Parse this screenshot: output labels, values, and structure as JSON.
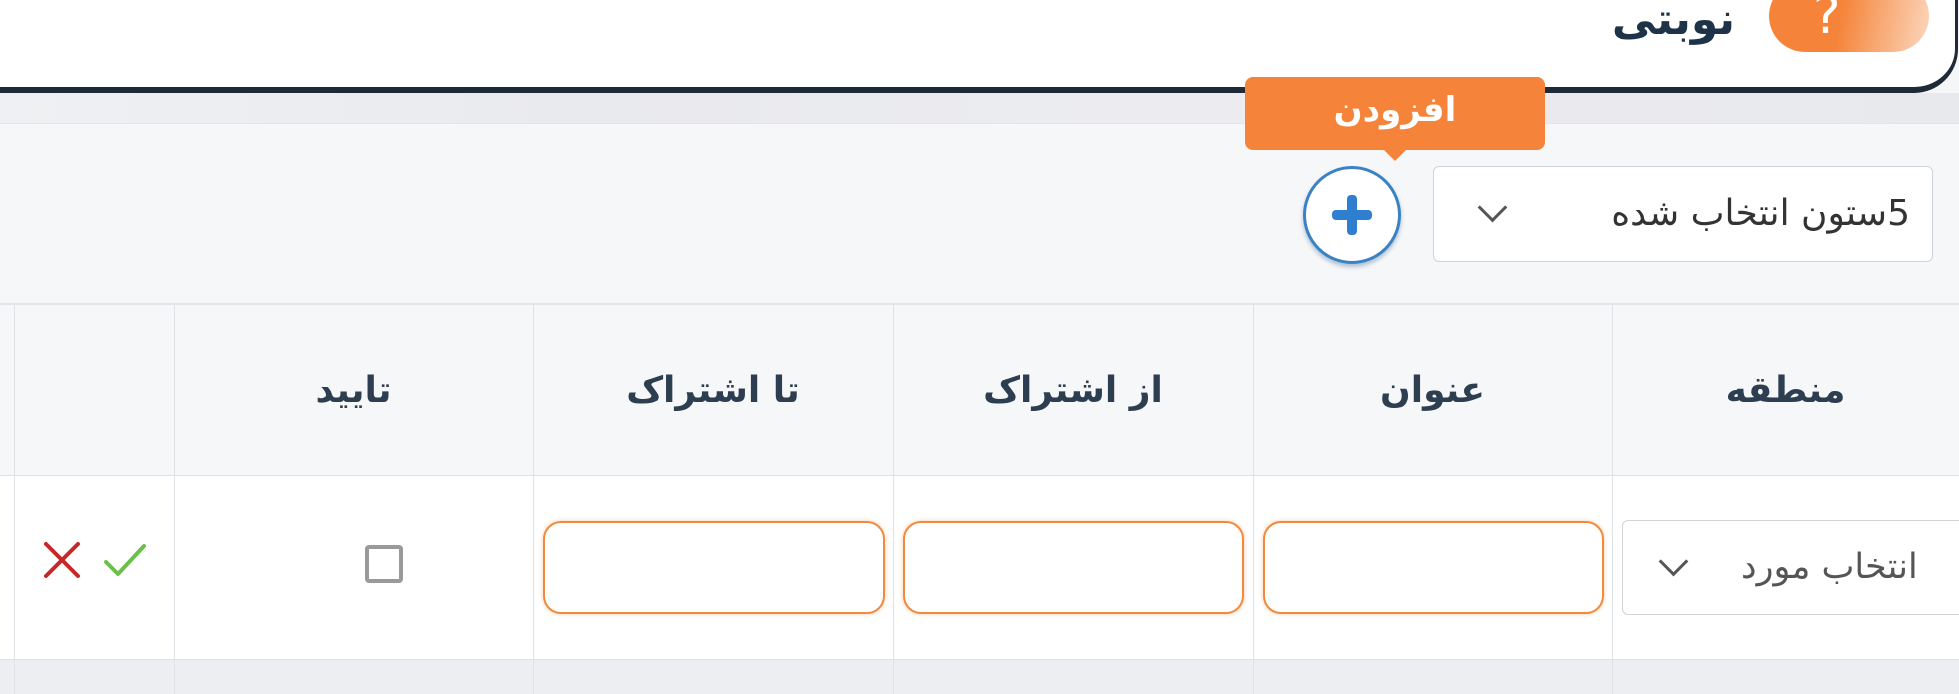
{
  "header": {
    "title": "نوبتی",
    "help_icon": "?"
  },
  "toolbar": {
    "column_select_value": "5ستون انتخاب شده",
    "add_tooltip": "افزودن",
    "add_icon": "plus-icon"
  },
  "table": {
    "columns": [
      "منطقه",
      "عنوان",
      "از اشتراک",
      "تا اشتراک",
      "تایید"
    ],
    "new_row": {
      "region_placeholder": "انتخاب مورد",
      "title": "",
      "from_subscription": "",
      "to_subscription": "",
      "approved": false
    }
  },
  "colors": {
    "accent": "#f5843a",
    "primary_blue": "#2f7fd0",
    "header_border": "#1e2a38",
    "confirm_green": "#6cc04a",
    "cancel_red": "#c62828"
  }
}
